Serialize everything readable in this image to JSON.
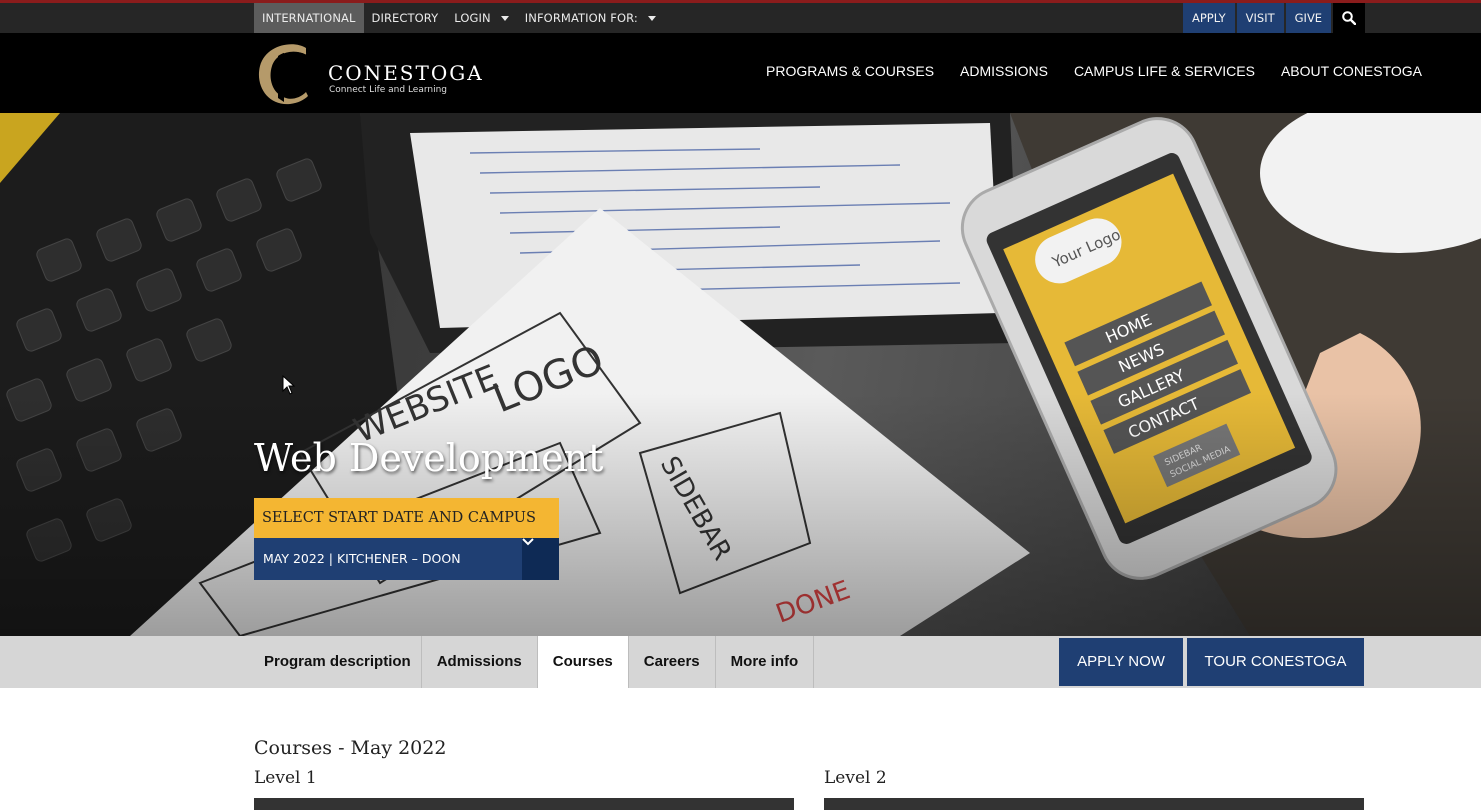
{
  "utility_bar": {
    "links": [
      "INTERNATIONAL",
      "DIRECTORY",
      "LOGIN",
      "INFORMATION FOR:"
    ],
    "buttons": [
      "APPLY",
      "VISIT",
      "GIVE"
    ],
    "search_icon": "search-icon"
  },
  "brand": {
    "name": "CONESTOGA",
    "tagline": "Connect Life and Learning",
    "logo_color": "#b59a6a"
  },
  "main_nav": [
    "PROGRAMS & COURSES",
    "ADMISSIONS",
    "CAMPUS LIFE & SERVICES",
    "ABOUT CONESTOGA"
  ],
  "hero": {
    "title": "Web Development",
    "select_label": "SELECT START DATE AND CAMPUS",
    "selected_value": "MAY 2022 | KITCHENER – DOON",
    "image_text": {
      "phone_logo": "Your Logo",
      "phone_menu": [
        "HOME",
        "NEWS",
        "GALLERY",
        "CONTACT"
      ],
      "phone_footer": "SIDEBAR SOCIAL MEDIA",
      "sketch": [
        "WEBSITE",
        "LOGO",
        "SIDEBAR"
      ]
    }
  },
  "tabs": {
    "items": [
      "Program description",
      "Admissions",
      "Courses",
      "Careers",
      "More info"
    ],
    "active": "Courses"
  },
  "cta": {
    "apply": "APPLY NOW",
    "tour": "TOUR CONESTOGA"
  },
  "content": {
    "title": "Courses - May 2022",
    "level1": "Level 1",
    "level2": "Level 2"
  },
  "colors": {
    "accent_blue": "#1f3f73",
    "accent_gold": "#f4b632",
    "top_border": "#8a1c1c"
  }
}
